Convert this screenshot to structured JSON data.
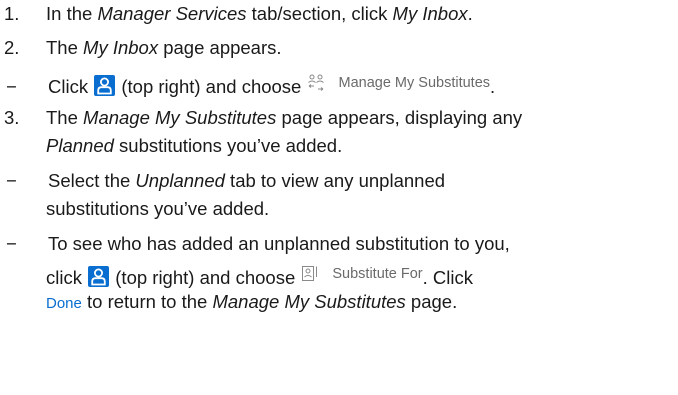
{
  "steps": {
    "s1": {
      "marker": "1.",
      "pre": "In the ",
      "em1": "Manager Services",
      "mid": " tab/section, click ",
      "em2": "My Inbox",
      "post": "."
    },
    "s2": {
      "marker": "2.",
      "pre": "The ",
      "em1": "My Inbox",
      "post": " page appears."
    },
    "b1": {
      "marker": "−",
      "pre": "Click ",
      "mid": " (top right) and choose ",
      "chip": "Manage My Substitutes",
      "post": "."
    },
    "s3": {
      "marker": "3.",
      "line1_pre": "The ",
      "line1_em": "Manage My Substitutes",
      "line1_post": " page appears, displaying any",
      "line2_em": "Planned",
      "line2_post": " substitutions you’ve added."
    },
    "b2": {
      "marker": "−",
      "line1_pre": "Select the ",
      "line1_em": "Unplanned",
      "line1_post": " tab to view any unplanned",
      "line2": "substitutions you’ve added."
    },
    "b3": {
      "marker": "−",
      "line1": "To see who has added an unplanned substitution to you,",
      "line2_pre": "click ",
      "line2_mid": " (top right) and choose ",
      "line2_chip": "Substitute For",
      "line2_post": ". Click",
      "line3_link": "Done",
      "line3_pre": " to return to the ",
      "line3_em": "Manage My Substitutes",
      "line3_post": " page."
    }
  },
  "icons": {
    "person_button": "person-icon",
    "substitutes": "substitutes-icon",
    "substitute_for": "substitute-for-icon"
  },
  "colors": {
    "person_button_bg": "#0a6ed1",
    "link": "#0a6ed1",
    "chip_text": "#6a6a6a"
  }
}
